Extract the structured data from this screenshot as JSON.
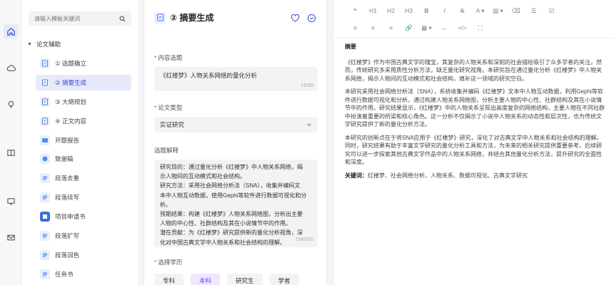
{
  "rail": {
    "icons": [
      "home-icon",
      "cloud-icon",
      "bulb-icon",
      "book-icon",
      "message-icon",
      "mail-icon"
    ]
  },
  "sidebar": {
    "search_placeholder": "请输入模板关键词",
    "section_label": "论文辅助",
    "items": [
      {
        "label": "① 选题确立",
        "icon": "document-icon"
      },
      {
        "label": "② 摘要生成",
        "icon": "document-icon"
      },
      {
        "label": "③ 大纲规划",
        "icon": "document-icon"
      },
      {
        "label": "④ 正文内容",
        "icon": "document-icon"
      },
      {
        "label": "开题报告",
        "icon": "report-icon"
      },
      {
        "label": "致谢稿",
        "icon": "thanks-icon"
      },
      {
        "label": "段落去重",
        "icon": "dedupe-icon"
      },
      {
        "label": "段落续写",
        "icon": "continue-icon"
      },
      {
        "label": "项目申请书",
        "icon": "application-icon"
      },
      {
        "label": "段落扩写",
        "icon": "expand-icon"
      },
      {
        "label": "段落润色",
        "icon": "polish-icon"
      },
      {
        "label": "任务书",
        "icon": "task-icon"
      }
    ]
  },
  "form": {
    "title": "② 摘要生成",
    "topic_label": "内容选题",
    "topic_value": "《红楼梦》人物关系网络的量化分析",
    "topic_count": "16/50",
    "type_label": "论文类型",
    "type_value": "实证研究",
    "explain_label": "选题解释",
    "explain_lines": [
      "研究目的：通过量化分析《红楼梦》中人物关系网络，揭",
      "示人物间的互动模式和社会结构。",
      "研究方法：采用社会网络分析法（SNA），收集并编码文",
      "本中人物互动数据，使用Gephi等软件进行数据可视化和分",
      "析。",
      "预期结果：构建《红楼梦》人物关系网络图，分析出主要",
      "人物的中心性、社群结构及其在小说情节中的作用。",
      "潜在贡献：为《红楼梦》研究提供新的量化分析视角，深",
      "化对中国古典文学中人物关系和社会结构的理解。"
    ],
    "explain_count": "194/200",
    "degree_label": "选择学历",
    "degrees": [
      "专科",
      "本科",
      "研究生",
      "学者"
    ],
    "degree_selected": "本科"
  },
  "toolbar": {
    "row1": [
      "❝",
      "H1",
      "H2",
      "H3",
      "B",
      "I",
      "S",
      "A ▾",
      "▨ ▾",
      "⌫",
      "☰",
      "☑"
    ],
    "row2": [
      "≡",
      "≡",
      "≡",
      "🔗",
      "▦ ▾",
      "↔",
      "</>",
      "⛶"
    ]
  },
  "document": {
    "heading": "摘要",
    "paragraphs": [
      "《红楼梦》作为中国古典文学的瑰宝，其复杂的人物关系和深刻的社会描绘吸引了众多学者的关注。然而，传统研究多采用质性分析方法，缺乏量化研究视角。本研究旨在通过量化分析《红楼梦》中人物关系网络，揭示人物间的互动模式和社会结构，填补这一领域的研究空白。",
      "本研究采用社会网络分析法（SNA），系统收集并编码《红楼梦》文本中人物互动数据，利用Gephi等软件进行数据可视化和分析。通过构建人物关系网络图，分析主要人物的中心性、社群结构及其在小说情节中的作用。研究结果显示，《红楼梦》中的人物关系呈现出高度复杂的网络结构，主要人物在不同社群中扮演着重要的桥梁和核心角色。这一分析不仅揭示了小说中人物关系的动态性和层次性，也为传统文学研究提供了新的量化分析方法。",
      "本研究的创新点在于将SNA应用于《红楼梦》研究，深化了对古典文学中人物关系和社会结构的理解。同时，研究结果有助于丰富文学研究的量化分析工具和方法，为未来的相关研究提供重要参考。后续研究可以进一步探索其他古典文学作品中的人物关系网络，并结合其他量化分析方法，提升研究的全面性和深度。"
    ],
    "keywords_label": "关键词：",
    "keywords": "红楼梦、社会网络分析、人物关系、数据可视化、古典文学研究"
  },
  "colors": {
    "accent": "#3b4cc0",
    "accent_bg": "#e7e9fb",
    "degree_sel_text": "#7b43e0",
    "degree_sel_bg": "#efe7fd"
  }
}
